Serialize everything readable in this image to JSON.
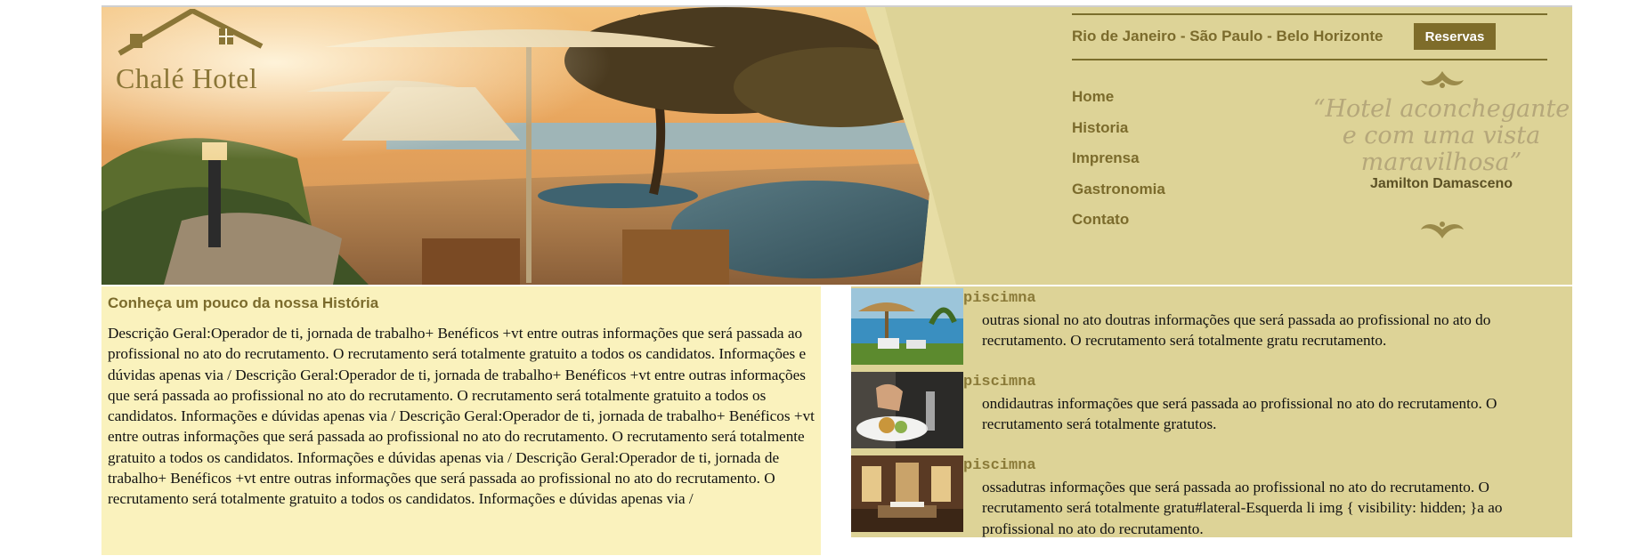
{
  "header": {
    "brand_name": "Chalé Hotel",
    "cities": "Rio de Janeiro - São Paulo - Belo Horizonte",
    "reserve_label": "Reservas",
    "nav": [
      "Home",
      "Historia",
      "Imprensa",
      "Gastronomia",
      "Contato"
    ],
    "quote": "“Hotel aconchegante e com uma vista maravilhosa”",
    "quote_author": "Jamilton Damasceno"
  },
  "history": {
    "title": "Conheça um pouco da nossa História",
    "text": "Descrição Geral:Operador de ti, jornada de trabalho+ Benéficos +vt entre outras informações que será passada ao profissional no ato do recrutamento. O recrutamento será totalmente gratuito a todos os candidatos. Informações e dúvidas apenas via / Descrição Geral:Operador de ti, jornada de trabalho+ Benéficos +vt entre outras informações que será passada ao profissional no ato do recrutamento. O recrutamento será totalmente gratuito a todos os candidatos. Informações e dúvidas apenas via / Descrição Geral:Operador de ti, jornada de trabalho+ Benéficos +vt entre outras informações que será passada ao profissional no ato do recrutamento. O recrutamento será totalmente gratuito a todos os candidatos. Informações e dúvidas apenas via / Descrição Geral:Operador de ti, jornada de trabalho+ Benéficos +vt entre outras informações que será passada ao profissional no ato do recrutamento. O recrutamento será totalmente gratuito a todos os candidatos. Informações e dúvidas apenas via /"
  },
  "news": [
    {
      "title": "piscimna",
      "text": "outras sional no ato doutras informações que será passada ao profissional no ato do recrutamento. O recrutamento será totalmente gratu recrutamento.",
      "thumb": "pool-thumbnail"
    },
    {
      "title": "piscimna",
      "text": "ondidautras informações que será passada ao profissional no ato do recrutamento. O recrutamento será totalmente gratutos.",
      "thumb": "dining-thumbnail"
    },
    {
      "title": "piscimna",
      "text": "ossadutras informações que será passada ao profissional no ato do recrutamento. O recrutamento será totalmente gratu#lateral-Esquerda li img { visibility: hidden; }a ao profissional no ato do recrutamento.",
      "thumb": "room-thumbnail"
    }
  ],
  "colors": {
    "header_bg": "#ddd397",
    "history_bg": "#faf2bd",
    "accent": "#7e6c2a",
    "heading": "#7b6b2c"
  }
}
